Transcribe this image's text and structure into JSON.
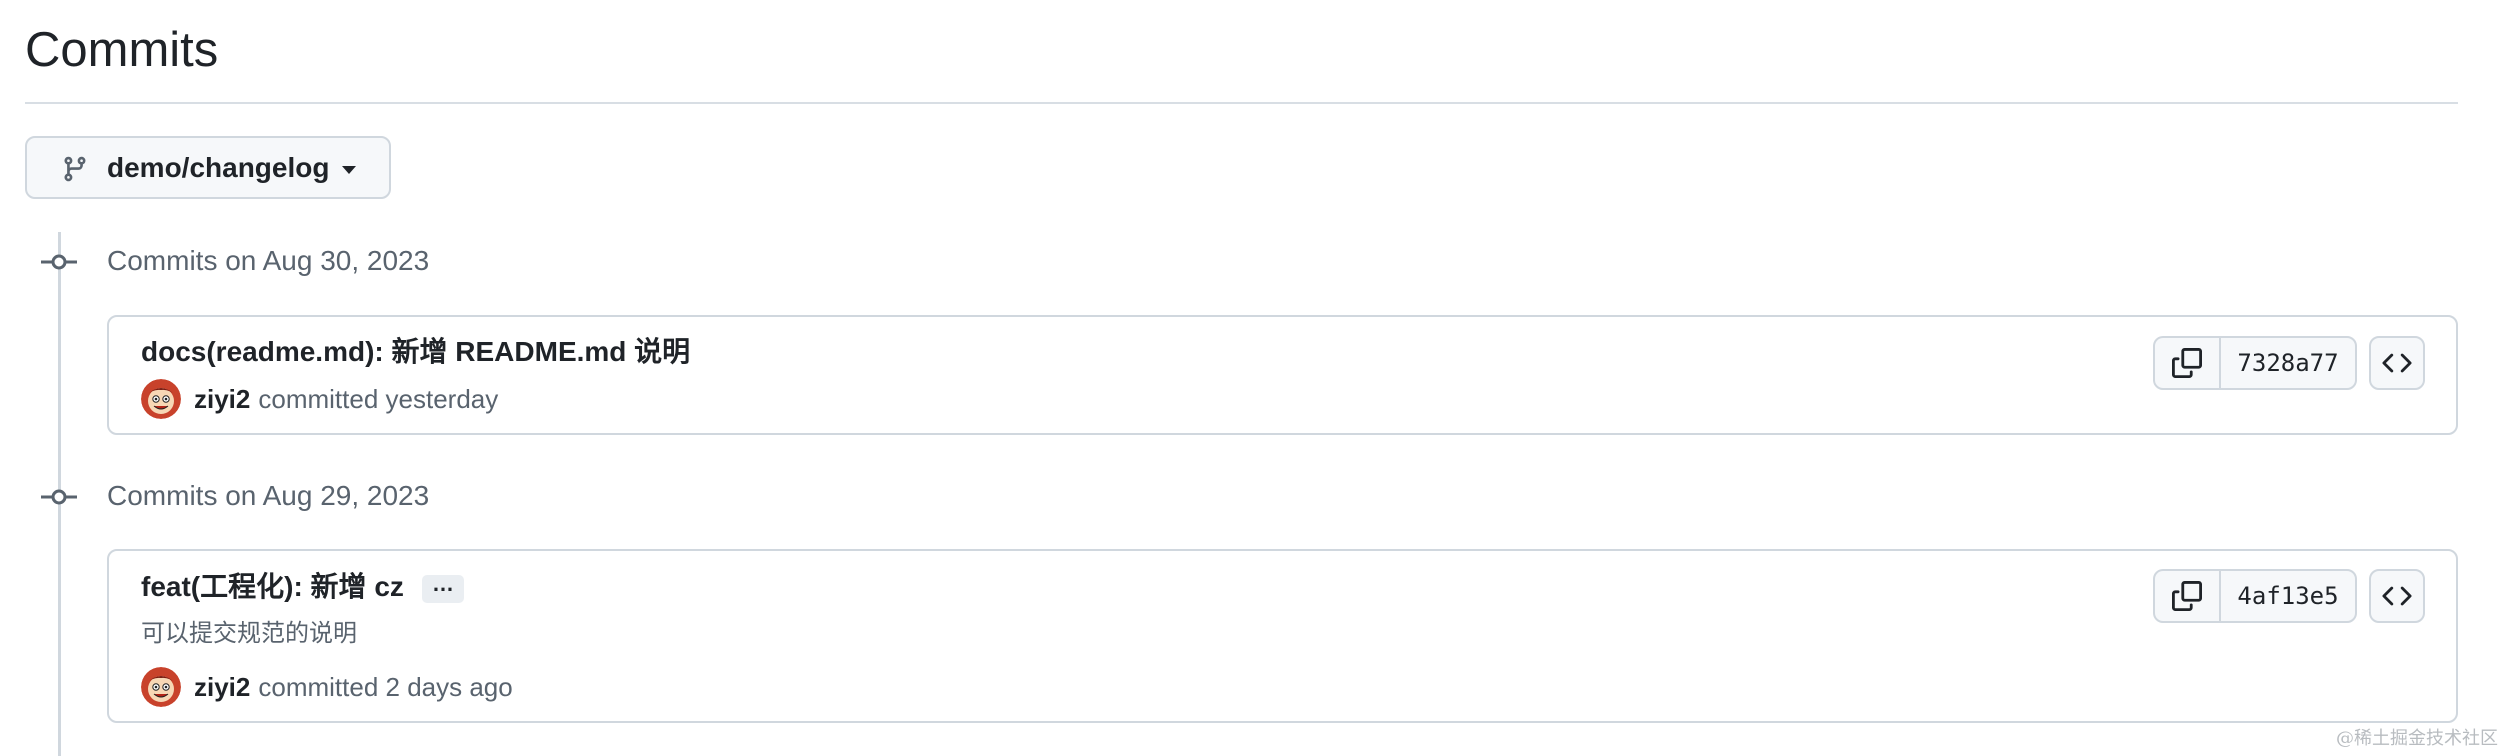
{
  "page": {
    "title": "Commits"
  },
  "branch_selector": {
    "label": "demo/changelog",
    "icon": "git-branch-icon",
    "caret_icon": "triangle-down-icon"
  },
  "commit_groups": [
    {
      "heading": "Commits on Aug 30, 2023",
      "commits": [
        {
          "title": "docs(readme.md): 新增 README.md 说明",
          "body": "",
          "author": "ziyi2",
          "committed_text": "committed yesterday",
          "sha": "7328a77"
        }
      ]
    },
    {
      "heading": "Commits on Aug 29, 2023",
      "commits": [
        {
          "title": "feat(工程化): 新增 cz",
          "expand_label": "…",
          "body": "可以提交规范的说明",
          "author": "ziyi2",
          "committed_text": "committed 2 days ago",
          "sha": "4af13e5"
        }
      ]
    }
  ],
  "icons": {
    "copy": "copy-icon",
    "browse": "code-icon",
    "timeline_node": "git-commit-icon",
    "avatar": "avatar"
  },
  "watermark": "@稀土掘金技术社区",
  "colors": {
    "text_primary": "#1f2328",
    "text_muted": "#59636e",
    "border": "#d0d7de",
    "button_bg": "#f6f8fa"
  }
}
